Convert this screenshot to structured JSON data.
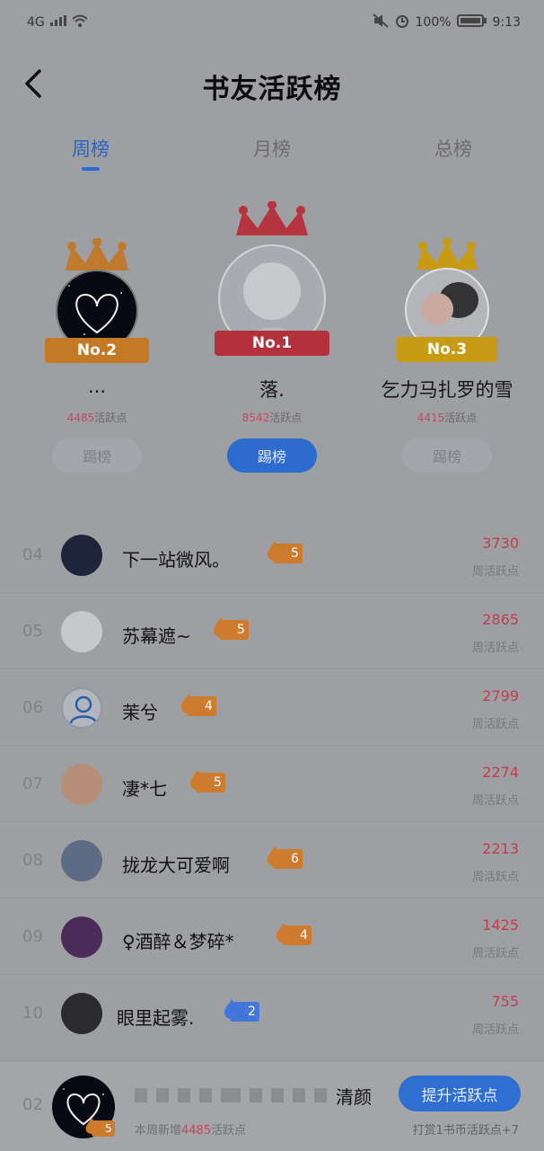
{
  "statusbar": {
    "network": "4G",
    "battery": "100%",
    "time": "9:13"
  },
  "header": {
    "title": "书友活跃榜"
  },
  "tabs": [
    {
      "label": "周榜"
    },
    {
      "label": "月榜"
    },
    {
      "label": "总榜"
    }
  ],
  "podium": {
    "first": {
      "badge": "No.1",
      "name": "落.",
      "points": "8542",
      "points_label": "活跃点",
      "button": "踢榜"
    },
    "second": {
      "badge": "No.2",
      "name": "...",
      "points": "4485",
      "points_label": "活跃点",
      "button": "踢榜"
    },
    "third": {
      "badge": "No.3",
      "name": "乞力马扎罗的雪",
      "points": "4415",
      "points_label": "活跃点",
      "button": "踢榜"
    }
  },
  "list": [
    {
      "rank": "04",
      "name": "下一站微风。",
      "level": "5",
      "score": "3730",
      "sub": "周活跃点"
    },
    {
      "rank": "05",
      "name": "苏幕遮~",
      "level": "5",
      "score": "2865",
      "sub": "周活跃点"
    },
    {
      "rank": "06",
      "name": "茉兮",
      "level": "4",
      "score": "2799",
      "sub": "周活跃点"
    },
    {
      "rank": "07",
      "name": "凄*七",
      "level": "5",
      "score": "2274",
      "sub": "周活跃点"
    },
    {
      "rank": "08",
      "name": "拢龙大可爱啊",
      "level": "6",
      "score": "2213",
      "sub": "周活跃点"
    },
    {
      "rank": "09",
      "name": "♀酒醉＆梦碎*",
      "level": "4",
      "score": "1425",
      "sub": "周活跃点"
    },
    {
      "rank": "10",
      "name": "眼里起雾.",
      "level": "2",
      "score": "755",
      "sub": "周活跃点"
    }
  ],
  "bottom": {
    "rank": "02",
    "name": "清颜",
    "level": "5",
    "sub_prefix": "本周新增",
    "sub_num": "4485",
    "sub_suffix": "活跃点",
    "boost_button": "提升活跃点",
    "reward": "打赏1书币活跃点+7"
  }
}
